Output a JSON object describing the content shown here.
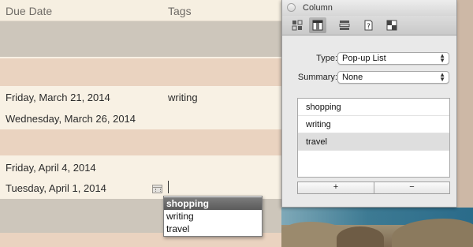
{
  "outline": {
    "columns": {
      "due_date": "Due Date",
      "tags": "Tags"
    },
    "rows": [
      {
        "due": "",
        "tags": "",
        "color": "#cdc6bb"
      },
      {
        "due": "",
        "tags": "",
        "color": "#f8f1e4"
      },
      {
        "due": "",
        "tags": "",
        "color": "#ead3c0"
      },
      {
        "due": "Friday, March 21, 2014",
        "tags": "writing",
        "color": "#f8f1e4"
      },
      {
        "due": "Wednesday, March 26, 2014",
        "tags": "",
        "color": "#f8f1e4"
      },
      {
        "due": "",
        "tags": "",
        "color": "#ead3c0"
      },
      {
        "due": "Friday, April 4, 2014",
        "tags": "",
        "color": "#f8f1e4"
      },
      {
        "due": "Tuesday, April 1, 2014",
        "tags": "",
        "color": "#f8f1e4"
      },
      {
        "due": "",
        "tags": "",
        "color": "#cdc6bb"
      },
      {
        "due": "",
        "tags": "",
        "color": "#ead3c0"
      }
    ]
  },
  "autocomplete": {
    "items": [
      "shopping",
      "writing",
      "travel"
    ]
  },
  "inspector": {
    "title": "Column",
    "toolbar_icons": [
      "column-layout-icon",
      "column-details-icon",
      "rows-icon",
      "help-document-icon",
      "style-icon"
    ],
    "type_label": "Type:",
    "type_value": "Pop-up List",
    "summary_label": "Summary:",
    "summary_value": "None",
    "list_items": [
      "shopping",
      "writing",
      "travel"
    ],
    "add_label": "+",
    "remove_label": "−"
  }
}
